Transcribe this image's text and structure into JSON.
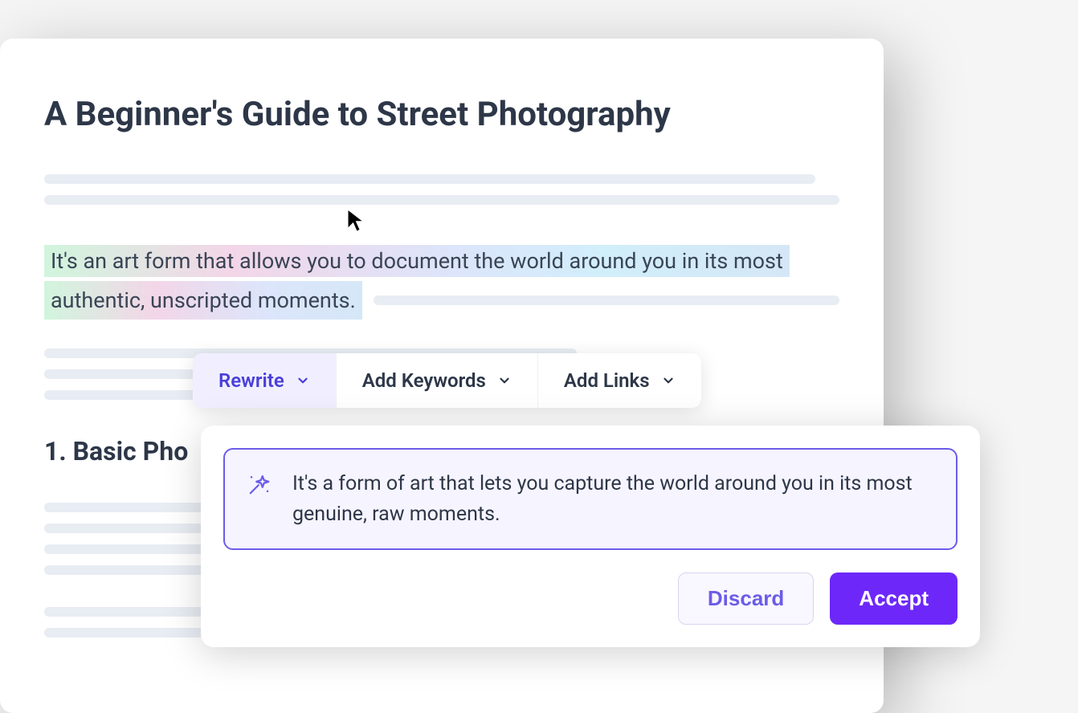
{
  "document": {
    "title": "A Beginner's Guide to Street Photography",
    "highlighted_text": "It's an art form that allows you to document the world around you in its most authentic, unscripted moments.",
    "highlighted_text_line1": "It's an art form that allows you to document the world around you in its most",
    "highlighted_text_line2": "authentic, unscripted moments.",
    "section_1_heading": "1. Basic Pho"
  },
  "toolbar": {
    "rewrite_label": "Rewrite",
    "add_keywords_label": "Add Keywords",
    "add_links_label": "Add Links"
  },
  "suggestion": {
    "text": "It's a form of art that lets you capture the world around you in its most genuine, raw moments.",
    "discard_label": "Discard",
    "accept_label": "Accept"
  },
  "colors": {
    "accent": "#6d28f9",
    "accent_light": "#6b5ce7",
    "text_primary": "#2d3748",
    "placeholder": "#e8ecf3"
  }
}
